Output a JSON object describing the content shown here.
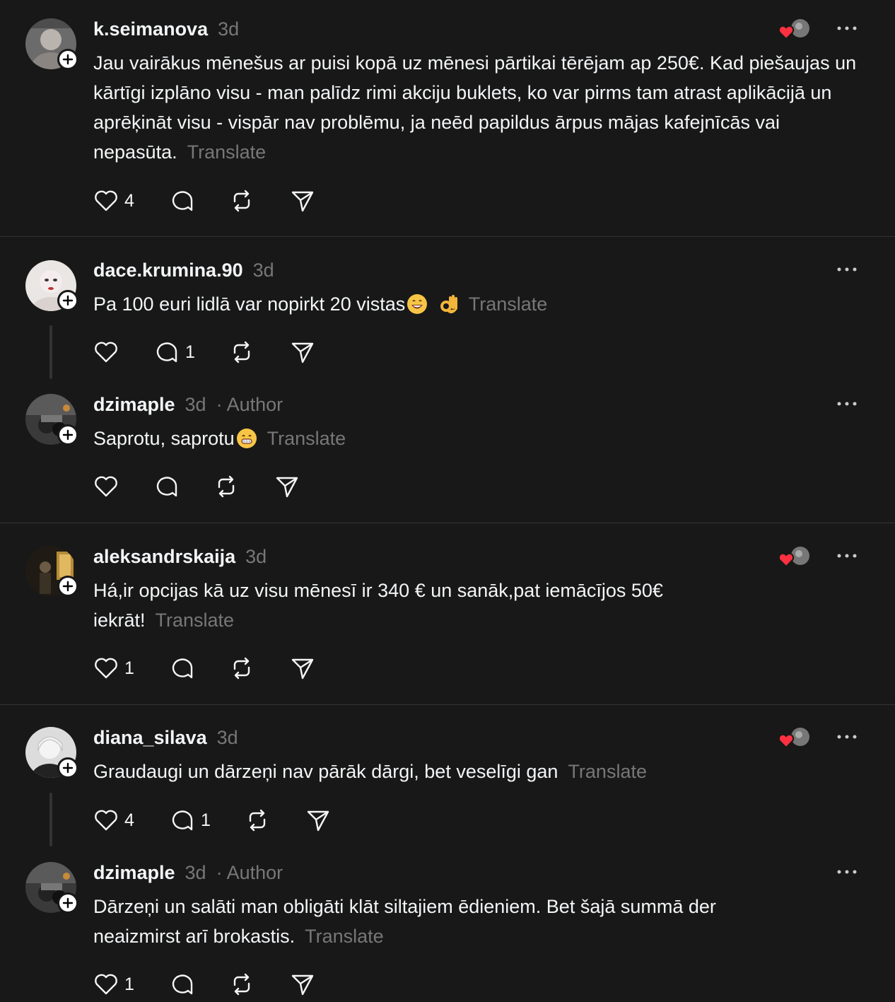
{
  "posts": [
    {
      "username": "k.seimanova",
      "time": "3d",
      "text": "Jau vairākus mēnešus ar puisi kopā uz mēnesi pārtikai tērējam ap 250€. Kad piešaujas un kārtīgi izplāno visu - man palīdz rimi akciju buklets, ko var pirms tam atrast aplikācijā un aprēķināt visu - vispār nav problēmu, ja neēd papildus ārpus mājas kafejnīcās vai nepasūta.",
      "translate": "Translate",
      "likes": "4"
    },
    {
      "username": "dace.krumina.90",
      "time": "3d",
      "text": "Pa 100 euri lidlā var nopirkt 20 vistas",
      "translate": "Translate",
      "replies": "1"
    },
    {
      "username": "dzimaple",
      "time": "3d",
      "author": "· Author",
      "text": "Saprotu, saprotu",
      "translate": "Translate"
    },
    {
      "username": "aleksandrskaija",
      "time": "3d",
      "text": "Há,ir opcijas kā uz visu mēnesī ir 340 € un sanāk,pat iemācījos 50€ iekrāt!",
      "translate": "Translate",
      "likes": "1"
    },
    {
      "username": "diana_silava",
      "time": "3d",
      "text": "Graudaugi un dārzeņi nav pārāk dārgi, bet veselīgi gan",
      "translate": "Translate",
      "likes": "4",
      "replies": "1"
    },
    {
      "username": "dzimaple",
      "time": "3d",
      "author": "· Author",
      "text": "Dārzeņi un salāti man obligāti klāt siltajiem ēdieniem. Bet šajā summā der neaizmirst arī brokastis.",
      "translate": "Translate",
      "likes": "1"
    }
  ],
  "colors": {
    "background": "#181818",
    "text": "#f3f5f7",
    "muted": "#777777",
    "divider": "#333333",
    "heart": "#ff3040"
  },
  "icons": [
    "heart-icon",
    "comment-icon",
    "repost-icon",
    "share-icon",
    "more-icon",
    "follow-plus-icon"
  ]
}
